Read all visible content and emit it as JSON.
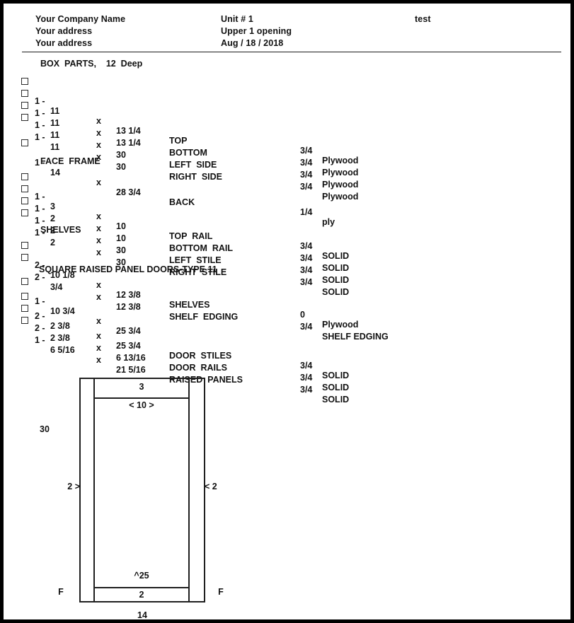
{
  "header": {
    "company_name": "Your Company Name",
    "address_line1": "Your address",
    "address_line2": "Your address",
    "unit": "Unit # 1",
    "opening": "Upper 1 opening",
    "date": "Aug / 18 / 2018",
    "job_label": "test"
  },
  "sections": {
    "box_parts": "BOX  PARTS,    12  Deep",
    "face_frame": "FACE  FRAME",
    "shelves": "SHELVES",
    "doors": "SQUARE RAISED PANEL DOORS-TYPE 11"
  },
  "parts": {
    "box": [
      {
        "qty": "1 -",
        "dim1": "11",
        "x": "x",
        "dim2": "13 1/4",
        "name": "TOP",
        "thickness": "3/4",
        "material": "Plywood"
      },
      {
        "qty": "1 -",
        "dim1": "11",
        "x": "x",
        "dim2": "13 1/4",
        "name": "BOTTOM",
        "thickness": "3/4",
        "material": "Plywood"
      },
      {
        "qty": "1 -",
        "dim1": "11",
        "x": "x",
        "dim2": "30",
        "name": "LEFT  SIDE",
        "thickness": "3/4",
        "material": "Plywood"
      },
      {
        "qty": "1 -",
        "dim1": "11",
        "x": "x",
        "dim2": "30",
        "name": "RIGHT  SIDE",
        "thickness": "3/4",
        "material": "Plywood"
      }
    ],
    "back": [
      {
        "qty": "1 -",
        "dim1": "14",
        "x": "x",
        "dim2": "28 3/4",
        "name": "BACK",
        "thickness": "1/4",
        "material": "ply"
      }
    ],
    "face_frame": [
      {
        "qty": "1 -",
        "dim1": "3",
        "x": "x",
        "dim2": "10",
        "name": "TOP  RAIL",
        "thickness": "3/4",
        "material": "SOLID"
      },
      {
        "qty": "1 -",
        "dim1": "2",
        "x": "x",
        "dim2": "10",
        "name": "BOTTOM  RAIL",
        "thickness": "3/4",
        "material": "SOLID"
      },
      {
        "qty": "1 -",
        "dim1": "2",
        "x": "x",
        "dim2": "30",
        "name": "LEFT  STILE",
        "thickness": "3/4",
        "material": "SOLID"
      },
      {
        "qty": "1 -",
        "dim1": "2",
        "x": "x",
        "dim2": "30",
        "name": "RIGHT  STILE",
        "thickness": "3/4",
        "material": "SOLID"
      }
    ],
    "shelves": [
      {
        "qty": "2 -",
        "dim1": "10 1/8",
        "x": "x",
        "dim2": "12 3/8",
        "name": "SHELVES",
        "thickness": "0",
        "material": "Plywood"
      },
      {
        "qty": "2 -",
        "dim1": "3/4",
        "x": "x",
        "dim2": "12 3/8",
        "name": "SHELF  EDGING",
        "thickness": "3/4",
        "material": "SHELF EDGING"
      }
    ],
    "door_size": [
      {
        "qty": "1 -",
        "dim1": "10 3/4",
        "x": "x",
        "dim2": "25 3/4",
        "name": "",
        "thickness": "",
        "material": ""
      }
    ],
    "doors": [
      {
        "qty": "2 -",
        "dim1": "2 3/8",
        "x": "x",
        "dim2": "25 3/4",
        "name": "DOOR  STILES",
        "thickness": "3/4",
        "material": "SOLID"
      },
      {
        "qty": "2 -",
        "dim1": "2 3/8",
        "x": "x",
        "dim2": "6 13/16",
        "name": "DOOR  RAILS",
        "thickness": "3/4",
        "material": "SOLID"
      },
      {
        "qty": "1 -",
        "dim1": "6 5/16",
        "x": "x",
        "dim2": "21 5/16",
        "name": "RAISED  PANELS",
        "thickness": "3/4",
        "material": "SOLID"
      }
    ]
  },
  "diagram": {
    "height_label": "30",
    "top_rail_label": "3",
    "width_inner_label": "< 10 >",
    "left_stile_label": "2 >",
    "right_stile_label": "< 2",
    "opening_height_label": "^25",
    "bottom_rail_label": "2",
    "overall_width_label": "14",
    "left_finish_label": "F",
    "right_finish_label": "F"
  }
}
